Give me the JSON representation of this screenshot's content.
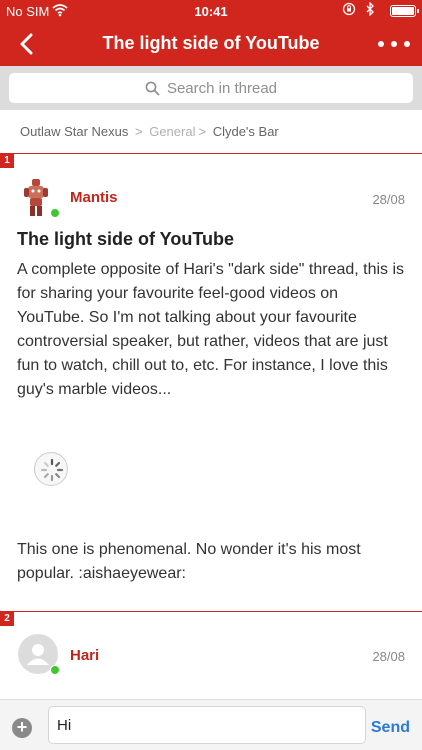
{
  "status_bar": {
    "carrier": "No SIM",
    "time": "10:41"
  },
  "header": {
    "title": "The light side of YouTube"
  },
  "search": {
    "placeholder": "Search in thread"
  },
  "breadcrumb": {
    "items": [
      "Outlaw Star Nexus",
      "General",
      "Clyde's Bar"
    ],
    "separator": ">"
  },
  "posts": [
    {
      "number": "1",
      "author": "Mantis",
      "date": "28/08",
      "title": "The light side of YouTube",
      "body": "A complete opposite of Hari's \"dark side\" thread, this is for sharing your favourite feel-good videos on YouTube. So I'm not talking about your favourite controversial speaker, but rather, videos that are just fun to watch, chill out to, etc. For instance, I love this guy's marble videos...",
      "body2": "This one is phenomenal. No wonder it's his most popular. :aishaeyewear:"
    },
    {
      "number": "2",
      "author": "Hari",
      "date": "28/08"
    }
  ],
  "composer": {
    "value": "Hi",
    "send_label": "Send"
  },
  "colors": {
    "accent": "#d0261d",
    "author": "#c0261d",
    "send": "#2a7ad8",
    "online": "#3ec82d"
  }
}
